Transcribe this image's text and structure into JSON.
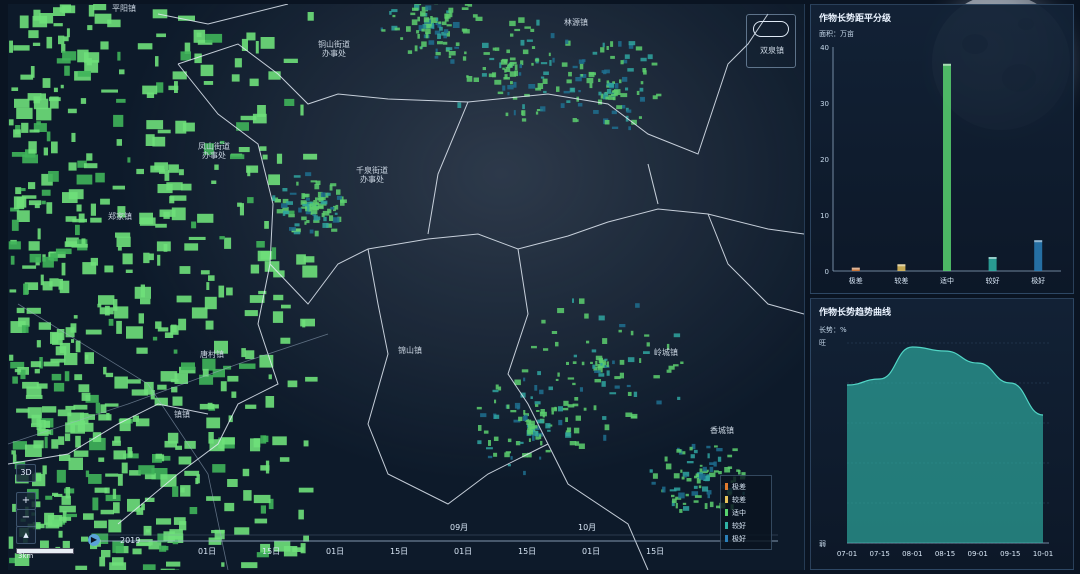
{
  "map": {
    "places": [
      {
        "id": "pingjiazhen",
        "text": "平阳镇"
      },
      {
        "id": "tongshan",
        "text": "铜山街道\n办事处"
      },
      {
        "id": "fengshan",
        "text": "凤山街道\n办事处"
      },
      {
        "id": "qianquan",
        "text": "千泉街道\n办事处"
      },
      {
        "id": "zhengjia",
        "text": "郑家镇"
      },
      {
        "id": "tangcun",
        "text": "唐村镇"
      },
      {
        "id": "zhenzhen",
        "text": "镇镇"
      },
      {
        "id": "jinshan",
        "text": "锦山镇"
      },
      {
        "id": "lingzhen",
        "text": "岭城镇"
      },
      {
        "id": "xiangcheng",
        "text": "香城镇"
      },
      {
        "id": "linyuan",
        "text": "林源镇"
      },
      {
        "id": "shuangquan",
        "text": "双泉镇"
      }
    ],
    "controls": {
      "mode_3d": "3D",
      "zoom_in": "+",
      "zoom_out": "−",
      "compass": "▲",
      "scale": "3km"
    },
    "timeline": {
      "year": "2019",
      "months": [
        "09月",
        "10月"
      ],
      "days": [
        "01日",
        "15日",
        "01日",
        "15日",
        "01日",
        "15日",
        "01日",
        "15日"
      ]
    },
    "legend": {
      "items": [
        {
          "label": "极差",
          "color": "#e07a2e"
        },
        {
          "label": "较差",
          "color": "#e5c25a"
        },
        {
          "label": "适中",
          "color": "#58d26e"
        },
        {
          "label": "较好",
          "color": "#2fb1a5"
        },
        {
          "label": "极好",
          "color": "#2a7fb8"
        }
      ]
    }
  },
  "panel_top": {
    "title": "作物长势距平分级",
    "unit": "面积：万亩",
    "chart_data": {
      "type": "bar",
      "categories": [
        "极差",
        "较差",
        "适中",
        "较好",
        "极好"
      ],
      "values": [
        0.6,
        1.2,
        37.0,
        2.5,
        5.5
      ],
      "colors": [
        "#e07a2e",
        "#e5c25a",
        "#58d26e",
        "#2fb1a5",
        "#2a7fb8"
      ],
      "ylim": [
        0,
        40
      ],
      "yticks": [
        0,
        10,
        20,
        30,
        40
      ],
      "xlabel": "",
      "ylabel": "面积：万亩",
      "title": "作物长势距平分级"
    }
  },
  "panel_bottom": {
    "title": "作物长势趋势曲线",
    "unit": "长势：%",
    "chart_data": {
      "type": "area",
      "x": [
        "07-01",
        "07-15",
        "08-01",
        "08-15",
        "09-01",
        "09-15",
        "10-01"
      ],
      "y_points": [
        {
          "x": "07-01",
          "y": 0.79
        },
        {
          "x": "07-15",
          "y": 0.82
        },
        {
          "x": "08-01",
          "y": 0.98
        },
        {
          "x": "08-15",
          "y": 0.96
        },
        {
          "x": "09-01",
          "y": 0.9
        },
        {
          "x": "09-15",
          "y": 0.8
        },
        {
          "x": "10-01",
          "y": 0.64
        }
      ],
      "ylabels": [
        "旺",
        "弱"
      ],
      "color": "#2fb1a5",
      "title": "作物长势趋势曲线",
      "ylabel": "长势：%"
    }
  }
}
